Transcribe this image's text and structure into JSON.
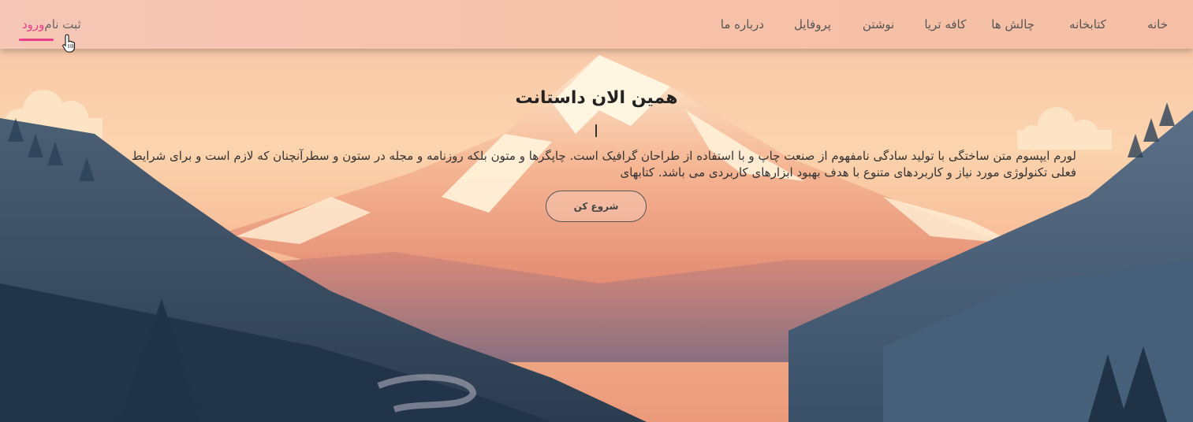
{
  "nav": {
    "items": [
      {
        "label": "خانه"
      },
      {
        "label": "کتابخانه"
      },
      {
        "label": "چالش ها"
      },
      {
        "label": "کافه تریا"
      },
      {
        "label": "نوشتن"
      },
      {
        "label": "پروفایل"
      },
      {
        "label": "درباره ما"
      }
    ]
  },
  "auth": {
    "login_label": "ورود",
    "register_label": "ثبت نام"
  },
  "hero": {
    "title": "همین الان داستانت",
    "text": "لورم ایپسوم متن ساختگی با تولید سادگی نامفهوم از صنعت چاپ و با استفاده از طراحان گرافیک است. چاپگرها و متون بلکه روزنامه و مجله در ستون و سطرآنچنان که لازم است و برای شرایط فعلی تکنولوژی مورد نیاز و کاربردهای متنوع با هدف بهبود ابزارهای کاربردی می باشد. کتابهای",
    "button_label": "شروع کن"
  },
  "colors": {
    "accent": "#e83e8c",
    "sky_top": "#f6c2a8",
    "mountain_snow": "#fff3dc",
    "forest_dark": "#2f4457"
  },
  "icons": {
    "moon": "moon-icon",
    "cursor": "hand-pointer-icon"
  }
}
